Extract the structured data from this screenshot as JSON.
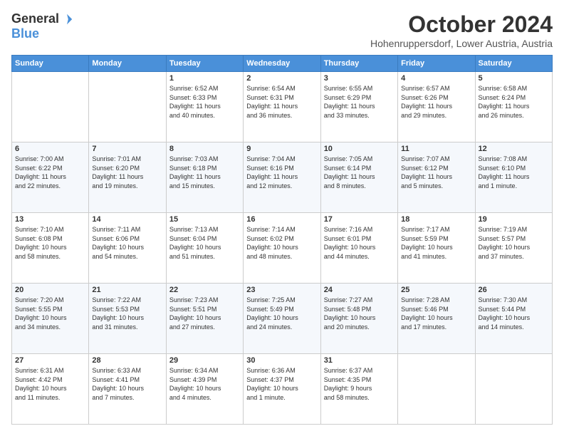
{
  "header": {
    "logo_general": "General",
    "logo_blue": "Blue",
    "title": "October 2024",
    "subtitle": "Hohenruppersdorf, Lower Austria, Austria"
  },
  "days_of_week": [
    "Sunday",
    "Monday",
    "Tuesday",
    "Wednesday",
    "Thursday",
    "Friday",
    "Saturday"
  ],
  "weeks": [
    [
      {
        "day": "",
        "info": ""
      },
      {
        "day": "",
        "info": ""
      },
      {
        "day": "1",
        "info": "Sunrise: 6:52 AM\nSunset: 6:33 PM\nDaylight: 11 hours\nand 40 minutes."
      },
      {
        "day": "2",
        "info": "Sunrise: 6:54 AM\nSunset: 6:31 PM\nDaylight: 11 hours\nand 36 minutes."
      },
      {
        "day": "3",
        "info": "Sunrise: 6:55 AM\nSunset: 6:29 PM\nDaylight: 11 hours\nand 33 minutes."
      },
      {
        "day": "4",
        "info": "Sunrise: 6:57 AM\nSunset: 6:26 PM\nDaylight: 11 hours\nand 29 minutes."
      },
      {
        "day": "5",
        "info": "Sunrise: 6:58 AM\nSunset: 6:24 PM\nDaylight: 11 hours\nand 26 minutes."
      }
    ],
    [
      {
        "day": "6",
        "info": "Sunrise: 7:00 AM\nSunset: 6:22 PM\nDaylight: 11 hours\nand 22 minutes."
      },
      {
        "day": "7",
        "info": "Sunrise: 7:01 AM\nSunset: 6:20 PM\nDaylight: 11 hours\nand 19 minutes."
      },
      {
        "day": "8",
        "info": "Sunrise: 7:03 AM\nSunset: 6:18 PM\nDaylight: 11 hours\nand 15 minutes."
      },
      {
        "day": "9",
        "info": "Sunrise: 7:04 AM\nSunset: 6:16 PM\nDaylight: 11 hours\nand 12 minutes."
      },
      {
        "day": "10",
        "info": "Sunrise: 7:05 AM\nSunset: 6:14 PM\nDaylight: 11 hours\nand 8 minutes."
      },
      {
        "day": "11",
        "info": "Sunrise: 7:07 AM\nSunset: 6:12 PM\nDaylight: 11 hours\nand 5 minutes."
      },
      {
        "day": "12",
        "info": "Sunrise: 7:08 AM\nSunset: 6:10 PM\nDaylight: 11 hours\nand 1 minute."
      }
    ],
    [
      {
        "day": "13",
        "info": "Sunrise: 7:10 AM\nSunset: 6:08 PM\nDaylight: 10 hours\nand 58 minutes."
      },
      {
        "day": "14",
        "info": "Sunrise: 7:11 AM\nSunset: 6:06 PM\nDaylight: 10 hours\nand 54 minutes."
      },
      {
        "day": "15",
        "info": "Sunrise: 7:13 AM\nSunset: 6:04 PM\nDaylight: 10 hours\nand 51 minutes."
      },
      {
        "day": "16",
        "info": "Sunrise: 7:14 AM\nSunset: 6:02 PM\nDaylight: 10 hours\nand 48 minutes."
      },
      {
        "day": "17",
        "info": "Sunrise: 7:16 AM\nSunset: 6:01 PM\nDaylight: 10 hours\nand 44 minutes."
      },
      {
        "day": "18",
        "info": "Sunrise: 7:17 AM\nSunset: 5:59 PM\nDaylight: 10 hours\nand 41 minutes."
      },
      {
        "day": "19",
        "info": "Sunrise: 7:19 AM\nSunset: 5:57 PM\nDaylight: 10 hours\nand 37 minutes."
      }
    ],
    [
      {
        "day": "20",
        "info": "Sunrise: 7:20 AM\nSunset: 5:55 PM\nDaylight: 10 hours\nand 34 minutes."
      },
      {
        "day": "21",
        "info": "Sunrise: 7:22 AM\nSunset: 5:53 PM\nDaylight: 10 hours\nand 31 minutes."
      },
      {
        "day": "22",
        "info": "Sunrise: 7:23 AM\nSunset: 5:51 PM\nDaylight: 10 hours\nand 27 minutes."
      },
      {
        "day": "23",
        "info": "Sunrise: 7:25 AM\nSunset: 5:49 PM\nDaylight: 10 hours\nand 24 minutes."
      },
      {
        "day": "24",
        "info": "Sunrise: 7:27 AM\nSunset: 5:48 PM\nDaylight: 10 hours\nand 20 minutes."
      },
      {
        "day": "25",
        "info": "Sunrise: 7:28 AM\nSunset: 5:46 PM\nDaylight: 10 hours\nand 17 minutes."
      },
      {
        "day": "26",
        "info": "Sunrise: 7:30 AM\nSunset: 5:44 PM\nDaylight: 10 hours\nand 14 minutes."
      }
    ],
    [
      {
        "day": "27",
        "info": "Sunrise: 6:31 AM\nSunset: 4:42 PM\nDaylight: 10 hours\nand 11 minutes."
      },
      {
        "day": "28",
        "info": "Sunrise: 6:33 AM\nSunset: 4:41 PM\nDaylight: 10 hours\nand 7 minutes."
      },
      {
        "day": "29",
        "info": "Sunrise: 6:34 AM\nSunset: 4:39 PM\nDaylight: 10 hours\nand 4 minutes."
      },
      {
        "day": "30",
        "info": "Sunrise: 6:36 AM\nSunset: 4:37 PM\nDaylight: 10 hours\nand 1 minute."
      },
      {
        "day": "31",
        "info": "Sunrise: 6:37 AM\nSunset: 4:35 PM\nDaylight: 9 hours\nand 58 minutes."
      },
      {
        "day": "",
        "info": ""
      },
      {
        "day": "",
        "info": ""
      }
    ]
  ]
}
